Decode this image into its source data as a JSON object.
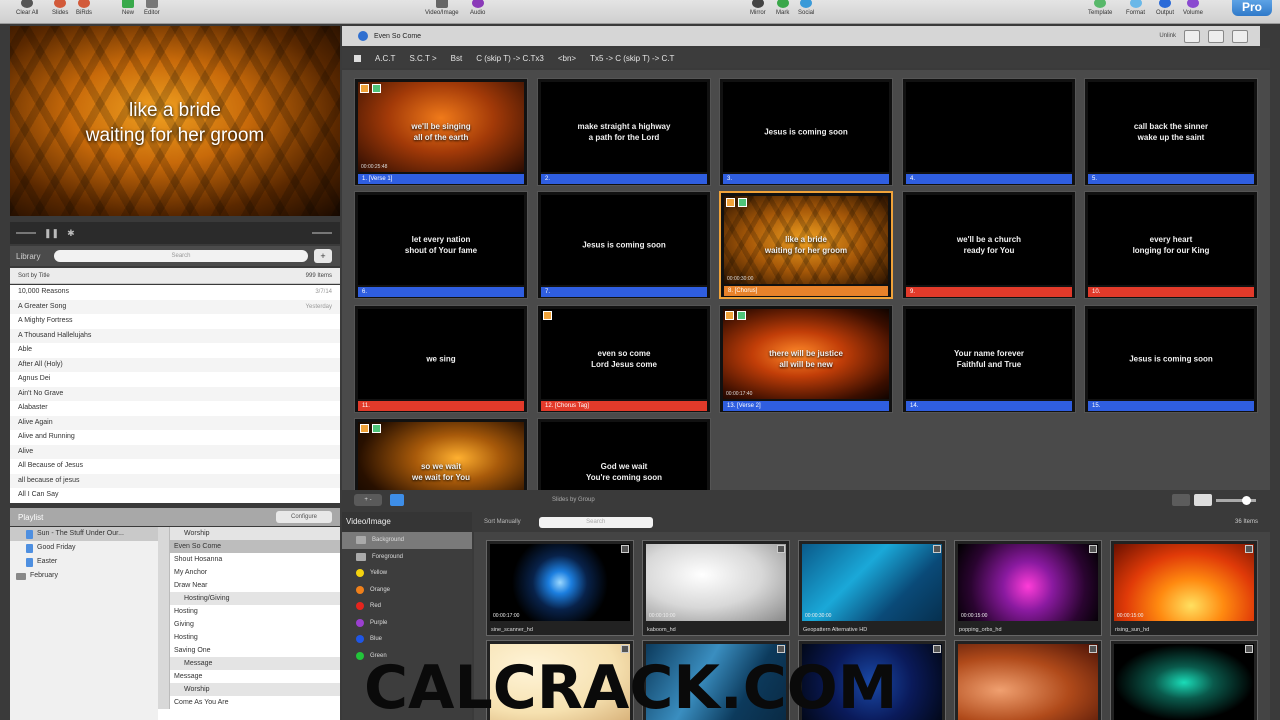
{
  "toolbar": {
    "left": [
      "Clear All",
      "Slides",
      "BiRds",
      "New",
      "Editor"
    ],
    "center": [
      "Video/Image",
      "Audio"
    ],
    "mid_right": [
      "Mirror",
      "Mark",
      "Social"
    ],
    "right": [
      "Template",
      "Format",
      "Output",
      "Volume"
    ],
    "brand": "Pro"
  },
  "preview": {
    "line1": "like a bride",
    "line2": "waiting for her groom"
  },
  "library": {
    "title": "Library",
    "search_placeholder": "Search",
    "add": "+",
    "sort_label": "Sort by Title",
    "count": "999 Items",
    "items": [
      {
        "title": "10,000 Reasons",
        "meta": "3/7/14"
      },
      {
        "title": "A Greater Song",
        "meta": "Yesterday"
      },
      {
        "title": "A Mighty Fortress",
        "meta": ""
      },
      {
        "title": "A Thousand Hallelujahs",
        "meta": ""
      },
      {
        "title": "Able",
        "meta": ""
      },
      {
        "title": "After All (Holy)",
        "meta": ""
      },
      {
        "title": "Agnus Dei",
        "meta": ""
      },
      {
        "title": "Ain't No Grave",
        "meta": ""
      },
      {
        "title": "Alabaster",
        "meta": ""
      },
      {
        "title": "Alive Again",
        "meta": ""
      },
      {
        "title": "Alive and Running",
        "meta": ""
      },
      {
        "title": "Alive",
        "meta": ""
      },
      {
        "title": "All Because of Jesus",
        "meta": ""
      },
      {
        "title": "all because of jesus",
        "meta": ""
      },
      {
        "title": "All I Can Say",
        "meta": ""
      }
    ]
  },
  "playlist": {
    "title": "Playlist",
    "config_btn": "Configure",
    "tree": [
      {
        "label": "Sun - The Stuff Under Our...",
        "sel": true,
        "type": "doc"
      },
      {
        "label": "Good Friday",
        "sel": false,
        "type": "doc"
      },
      {
        "label": "Easter",
        "sel": false,
        "type": "doc"
      },
      {
        "label": "February",
        "sel": false,
        "type": "folder"
      }
    ],
    "items": [
      {
        "label": "Worship",
        "hdr": true,
        "sel": false
      },
      {
        "label": "Even So Come",
        "hdr": false,
        "sel": true
      },
      {
        "label": "Shout Hosanna",
        "hdr": false,
        "sel": false
      },
      {
        "label": "My Anchor",
        "hdr": false,
        "sel": false
      },
      {
        "label": "Draw Near",
        "hdr": false,
        "sel": false
      },
      {
        "label": "Hosting/Giving",
        "hdr": true,
        "sel": false
      },
      {
        "label": "Hosting",
        "hdr": false,
        "sel": false
      },
      {
        "label": "Giving",
        "hdr": false,
        "sel": false
      },
      {
        "label": "Hosting",
        "hdr": false,
        "sel": false
      },
      {
        "label": "Saving One",
        "hdr": false,
        "sel": false
      },
      {
        "label": "Message",
        "hdr": true,
        "sel": false
      },
      {
        "label": "Message",
        "hdr": false,
        "sel": false
      },
      {
        "label": "Worship",
        "hdr": true,
        "sel": false
      },
      {
        "label": "Come As You Are",
        "hdr": false,
        "sel": false
      }
    ]
  },
  "document": {
    "title": "Even So Come",
    "status": "Unlink"
  },
  "arrangement": [
    "A.C.T",
    "S.C.T >",
    "Bst",
    "C (skip T) -> C.Tx3",
    "<bn>",
    "Tx5 -> C (skip T) -> C.T"
  ],
  "slides": [
    {
      "text": "we'll be singing\nall of the earth",
      "label": "1. [Verse 1]",
      "color": "blue",
      "bg": "fire",
      "badges": true,
      "tc": "00:00:25:48",
      "sel": false
    },
    {
      "text": "make straight a highway\na path for the Lord",
      "label": "2.",
      "color": "blue",
      "bg": "",
      "badges": false,
      "tc": "",
      "sel": false
    },
    {
      "text": "Jesus is coming soon",
      "label": "3.",
      "color": "blue",
      "bg": "",
      "badges": false,
      "tc": "",
      "sel": false
    },
    {
      "text": "",
      "label": "4.",
      "color": "blue",
      "bg": "",
      "badges": false,
      "tc": "",
      "sel": false
    },
    {
      "text": "call back the sinner\nwake up the saint",
      "label": "5.",
      "color": "blue",
      "bg": "",
      "badges": false,
      "tc": "",
      "sel": false
    },
    {
      "text": "let every nation\nshout of Your fame",
      "label": "6.",
      "color": "blue",
      "bg": "",
      "badges": false,
      "tc": "",
      "sel": false
    },
    {
      "text": "Jesus is coming soon",
      "label": "7.",
      "color": "blue",
      "bg": "",
      "badges": false,
      "tc": "",
      "sel": false
    },
    {
      "text": "like a bride\nwaiting for her groom",
      "label": "8. [Chorus]",
      "color": "orange",
      "bg": "gold",
      "badges": true,
      "tc": "00:00:30:00",
      "sel": true
    },
    {
      "text": "we'll be a church\nready for You",
      "label": "9.",
      "color": "red",
      "bg": "",
      "badges": false,
      "tc": "",
      "sel": false
    },
    {
      "text": "every heart\nlonging for our King",
      "label": "10.",
      "color": "red",
      "bg": "",
      "badges": false,
      "tc": "",
      "sel": false
    },
    {
      "text": "we sing",
      "label": "11.",
      "color": "red",
      "bg": "",
      "badges": false,
      "tc": "",
      "sel": false
    },
    {
      "text": "even so come\nLord Jesus come",
      "label": "12. [Chorus Tag]",
      "color": "red",
      "bg": "",
      "badges": true,
      "tc": "",
      "sel": false
    },
    {
      "text": "there will be justice\nall will be new",
      "label": "13. [Verse 2]",
      "color": "blue",
      "bg": "flower",
      "badges": true,
      "tc": "00:00:17:40",
      "sel": false
    },
    {
      "text": "Your name forever\nFaithful and True",
      "label": "14.",
      "color": "blue",
      "bg": "",
      "badges": false,
      "tc": "",
      "sel": false
    },
    {
      "text": "Jesus is coming soon",
      "label": "15.",
      "color": "blue",
      "bg": "",
      "badges": false,
      "tc": "",
      "sel": false
    },
    {
      "text": "so we wait\nwe wait for You",
      "label": "",
      "color": "",
      "bg": "galaxy",
      "badges": true,
      "tc": "",
      "sel": false
    },
    {
      "text": "God we wait\nYou're coming soon",
      "label": "",
      "color": "",
      "bg": "",
      "badges": false,
      "tc": "",
      "sel": false
    }
  ],
  "grid_footer": {
    "add": "+ -",
    "center": "Slides by Group"
  },
  "media": {
    "header": "Video/Image",
    "sort": "Sort Manually",
    "search_placeholder": "Search",
    "count": "36 Items",
    "categories": [
      {
        "label": "Background",
        "color": "#bbbbbb",
        "folder": true
      },
      {
        "label": "Foreground",
        "color": "#bbbbbb",
        "folder": true
      },
      {
        "label": "Yellow",
        "color": "#f5d30f",
        "folder": false
      },
      {
        "label": "Orange",
        "color": "#f0801a",
        "folder": false
      },
      {
        "label": "Red",
        "color": "#e5241d",
        "folder": false
      },
      {
        "label": "Purple",
        "color": "#9b3fd0",
        "folder": false
      },
      {
        "label": "Blue",
        "color": "#1f56e6",
        "folder": false
      },
      {
        "label": "Green",
        "color": "#22c43a",
        "folder": false
      }
    ],
    "thumbs": [
      {
        "name": "sine_scanner_hd",
        "tc": "00:00:17:00",
        "style": "radial-gradient(circle at 50% 50%, #9bd8ff 0%, #1c7fe0 14%, #08224a 34%, #000 60%)"
      },
      {
        "name": "kaboom_hd",
        "tc": "00:00:10:00",
        "style": "radial-gradient(ellipse at 40% 40%, #ffffff 0%, #d8d8d8 50%, #8a8a8a 100%)"
      },
      {
        "name": "Geopattern Alternative HD",
        "tc": "00:00:30:00",
        "style": "linear-gradient(135deg, #0a5a8a 0%, #1aa8d8 40%, #0a4a78 70%, #06304f 100%)"
      },
      {
        "name": "popping_orbs_hd",
        "tc": "00:00:15:00",
        "style": "radial-gradient(circle at 50% 55%, #ff3cd8 0%, #8a1aa0 30%, #2a0430 70%, #000 100%)"
      },
      {
        "name": "rising_sun_hd",
        "tc": "00:00:15:00",
        "style": "radial-gradient(ellipse at 55% 80%, #ffe060 0%, #ff8a10 30%, #e03a08 60%, #6a1000 100%)"
      },
      {
        "name": "",
        "tc": "",
        "style": "radial-gradient(ellipse at 30% 30%, #fff4d8 0%, #f6e1b0 60%, #d8b27a 100%)"
      },
      {
        "name": "",
        "tc": "",
        "style": "linear-gradient(120deg, #0c3a5c 0%, #3a8ec0 40%, #0c3a5c 70%, #0a2a44 100%)"
      },
      {
        "name": "",
        "tc": "",
        "style": "radial-gradient(circle at 50% 50%, #1a4aa8 0%, #0a1a5a 50%, #020818 100%)"
      },
      {
        "name": "",
        "tc": "",
        "style": "radial-gradient(ellipse at 30% 60%, #f0a070 0%, #b04a1a 50%, #4a1206 100%)"
      },
      {
        "name": "",
        "tc": "",
        "style": "radial-gradient(ellipse at 50% 50%, #1adcb8 0%, #0a5a4c 30%, #000 70%)"
      }
    ]
  },
  "watermark": "CALCRACK.COM"
}
